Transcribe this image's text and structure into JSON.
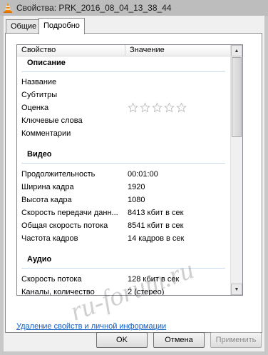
{
  "window": {
    "title": "Свойства: PRK_2016_08_04_13_38_44",
    "icon": "vlc-cone-icon"
  },
  "tabs": [
    {
      "label": "Общие"
    },
    {
      "label": "Подробно"
    }
  ],
  "columns": {
    "property": "Свойство",
    "value": "Значение"
  },
  "sections": {
    "description": {
      "label": "Описание",
      "rows": [
        {
          "name": "Название",
          "value": ""
        },
        {
          "name": "Субтитры",
          "value": ""
        },
        {
          "name": "Оценка",
          "value": "",
          "rating_stars": 5,
          "rating_filled": 0
        },
        {
          "name": "Ключевые слова",
          "value": ""
        },
        {
          "name": "Комментарии",
          "value": ""
        }
      ]
    },
    "video": {
      "label": "Видео",
      "rows": [
        {
          "name": "Продолжительность",
          "value": "00:01:00"
        },
        {
          "name": "Ширина кадра",
          "value": "1920"
        },
        {
          "name": "Высота кадра",
          "value": "1080"
        },
        {
          "name": "Скорость передачи данн...",
          "value": "8413 кбит в сек"
        },
        {
          "name": "Общая скорость потока",
          "value": "8541 кбит в сек"
        },
        {
          "name": "Частота кадров",
          "value": "14 кадров в сек"
        }
      ]
    },
    "audio": {
      "label": "Аудио",
      "rows": [
        {
          "name": "Скорость потока",
          "value": "128 кбит в сек"
        },
        {
          "name": "Каналы, количество",
          "value": "2 (стерео)"
        }
      ]
    }
  },
  "remove_link": "Удаление свойств и личной информации",
  "buttons": {
    "ok": "OK",
    "cancel": "Отмена",
    "apply": "Применить"
  },
  "watermark": "ru-forum.ru"
}
